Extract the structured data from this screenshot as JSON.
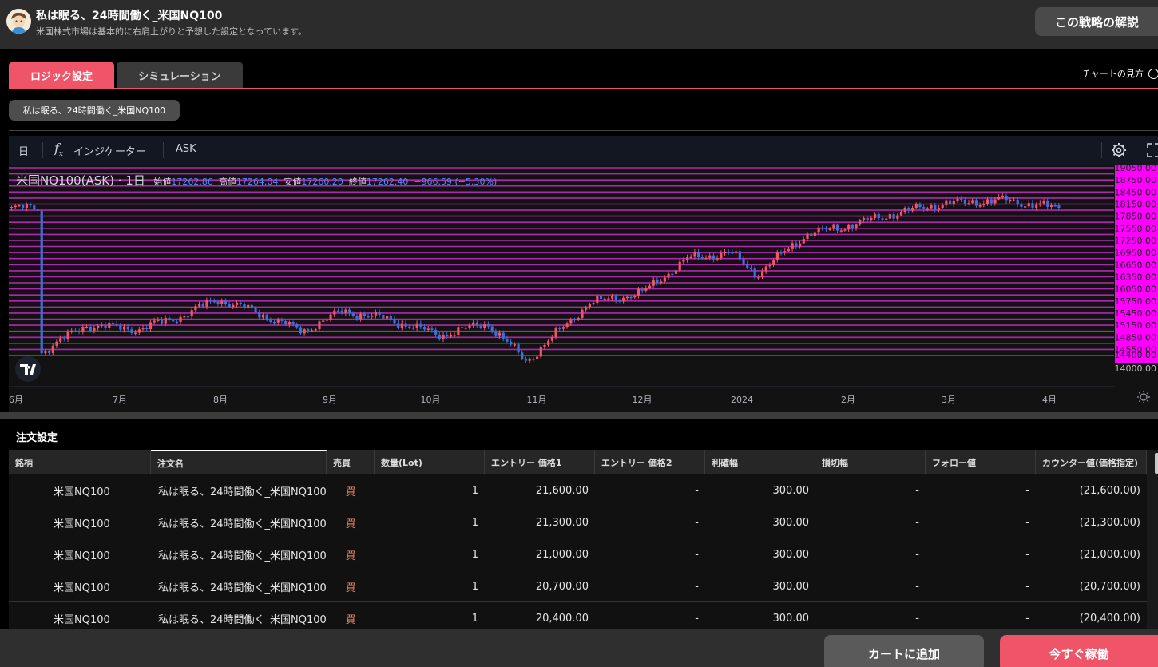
{
  "header": {
    "title": "私は眠る、24時間働く_米国NQ100",
    "subtitle": "米国株式市場は基本的に右肩上がりと予想した設定となっています。",
    "explain_button": "この戦略の解説"
  },
  "tabs": [
    {
      "label": "ロジック設定",
      "active": true
    },
    {
      "label": "シミュレーション",
      "active": false
    }
  ],
  "chart_help_link": "チャートの見方",
  "strategy_chip": "私は眠る、24時間働く_米国NQ100",
  "chart_toolbar": {
    "interval": "日",
    "indicator_label": "インジケーター",
    "price_side": "ASK",
    "settings_icon": "gear-icon",
    "fullscreen_icon": "fullscreen-icon"
  },
  "legend": {
    "symbol": "米国NQ100(ASK) · 1日",
    "open_label": "始値",
    "open": "17262.86",
    "high_label": "高値",
    "high": "17264.04",
    "low_label": "安値",
    "low": "17260.20",
    "close_label": "終値",
    "close": "17262.40",
    "change": "−966.59 (−5.30%)"
  },
  "chart_data": {
    "type": "candlestick",
    "price_axis_labels": [
      "19050.00",
      "18750.00",
      "18450.00",
      "18150.00",
      "17850.00",
      "17550.00",
      "17250.00",
      "16950.00",
      "16650.00",
      "16350.00",
      "16050.00",
      "15750.00",
      "15450.00",
      "15150.00",
      "14850.00",
      "14550.00",
      "14400.00",
      "14000.00"
    ],
    "x_labels": [
      "6月",
      "7月",
      "8月",
      "9月",
      "10月",
      "11月",
      "12月",
      "2024",
      "2月",
      "3月",
      "4月"
    ],
    "order_line_color": "#b424b4",
    "order_label_bg": "#ff00ff",
    "up_color": "#f05468",
    "down_color": "#3f6fd8",
    "close_path": [
      [
        "2023-06-01",
        14450
      ],
      [
        "2023-06-15",
        15150
      ],
      [
        "2023-07-01",
        15050
      ],
      [
        "2023-07-15",
        15400
      ],
      [
        "2023-07-25",
        15800
      ],
      [
        "2023-08-05",
        15500
      ],
      [
        "2023-08-20",
        15000
      ],
      [
        "2023-09-01",
        15500
      ],
      [
        "2023-09-15",
        15300
      ],
      [
        "2023-10-01",
        14900
      ],
      [
        "2023-10-15",
        15200
      ],
      [
        "2023-10-27",
        14250
      ],
      [
        "2023-11-15",
        15700
      ],
      [
        "2023-12-01",
        15950
      ],
      [
        "2023-12-15",
        16800
      ],
      [
        "2023-12-28",
        16950
      ],
      [
        "2024-01-05",
        16400
      ],
      [
        "2024-01-20",
        17400
      ],
      [
        "2024-02-01",
        17600
      ],
      [
        "2024-02-15",
        17900
      ],
      [
        "2024-03-01",
        18150
      ],
      [
        "2024-03-20",
        18250
      ],
      [
        "2024-04-05",
        18050
      ]
    ]
  },
  "orders": {
    "title": "注文設定",
    "columns": [
      "銘柄",
      "注文名",
      "売買",
      "数量(Lot)",
      "エントリー 価格1",
      "エントリー 価格2",
      "利確幅",
      "損切幅",
      "フォロー値",
      "カウンター値(価格指定)"
    ],
    "rows": [
      [
        "米国NQ100",
        "私は眠る、24時間働く_米国NQ100",
        "買",
        "1",
        "21,600.00",
        "-",
        "300.00",
        "-",
        "-",
        "(21,600.00)"
      ],
      [
        "米国NQ100",
        "私は眠る、24時間働く_米国NQ100",
        "買",
        "1",
        "21,300.00",
        "-",
        "300.00",
        "-",
        "-",
        "(21,300.00)"
      ],
      [
        "米国NQ100",
        "私は眠る、24時間働く_米国NQ100",
        "買",
        "1",
        "21,000.00",
        "-",
        "300.00",
        "-",
        "-",
        "(21,000.00)"
      ],
      [
        "米国NQ100",
        "私は眠る、24時間働く_米国NQ100",
        "買",
        "1",
        "20,700.00",
        "-",
        "300.00",
        "-",
        "-",
        "(20,700.00)"
      ],
      [
        "米国NQ100",
        "私は眠る、24時間働く_米国NQ100",
        "買",
        "1",
        "20,400.00",
        "-",
        "300.00",
        "-",
        "-",
        "(20,400.00)"
      ]
    ]
  },
  "footer": {
    "cart_button": "カートに追加",
    "run_button": "今すぐ稼働"
  }
}
